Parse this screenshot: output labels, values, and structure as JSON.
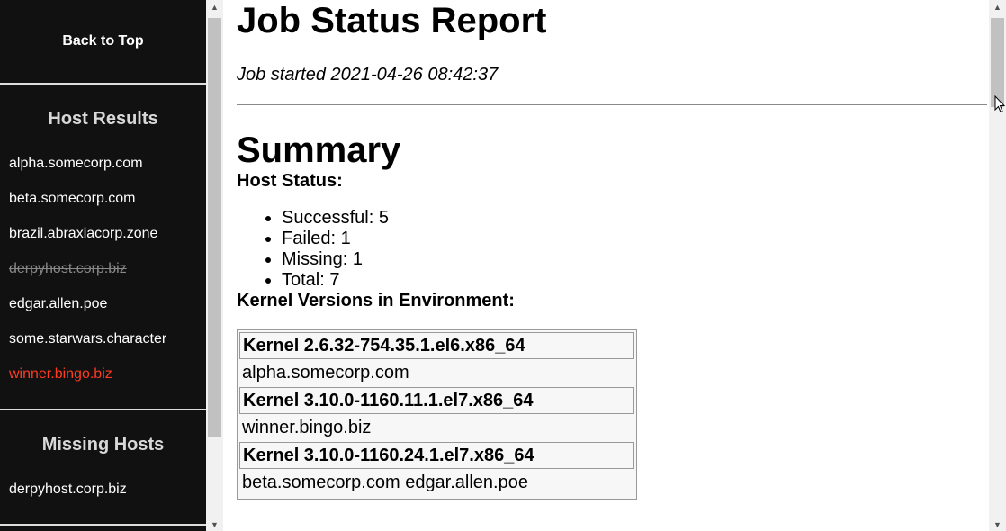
{
  "sidebar": {
    "back_to_top": "Back to Top",
    "host_results": {
      "heading": "Host Results",
      "items": [
        {
          "label": "alpha.somecorp.com",
          "status": "ok"
        },
        {
          "label": "beta.somecorp.com",
          "status": "ok"
        },
        {
          "label": "brazil.abraxiacorp.zone",
          "status": "ok"
        },
        {
          "label": "derpyhost.corp.biz",
          "status": "missing"
        },
        {
          "label": "edgar.allen.poe",
          "status": "ok"
        },
        {
          "label": "some.starwars.character",
          "status": "ok"
        },
        {
          "label": "winner.bingo.biz",
          "status": "failed"
        }
      ]
    },
    "missing_hosts": {
      "heading": "Missing Hosts",
      "items": [
        "derpyhost.corp.biz"
      ]
    }
  },
  "main": {
    "title": "Job Status Report",
    "started": "Job started 2021-04-26 08:42:37",
    "summary_heading": "Summary",
    "host_status": {
      "heading": "Host Status:",
      "items": [
        "Successful: 5",
        "Failed: 1",
        "Missing: 1",
        "Total: 7"
      ]
    },
    "kernel_versions": {
      "heading": "Kernel Versions in Environment:",
      "groups": [
        {
          "kernel": "Kernel 2.6.32-754.35.1.el6.x86_64",
          "hosts": "alpha.somecorp.com"
        },
        {
          "kernel": "Kernel 3.10.0-1160.11.1.el7.x86_64",
          "hosts": "winner.bingo.biz"
        },
        {
          "kernel": "Kernel 3.10.0-1160.24.1.el7.x86_64",
          "hosts": "beta.somecorp.com edgar.allen.poe"
        }
      ]
    }
  },
  "colors": {
    "sidebar_bg": "#111111",
    "failed_host": "#ff3b1f",
    "missing_host": "#888888"
  }
}
